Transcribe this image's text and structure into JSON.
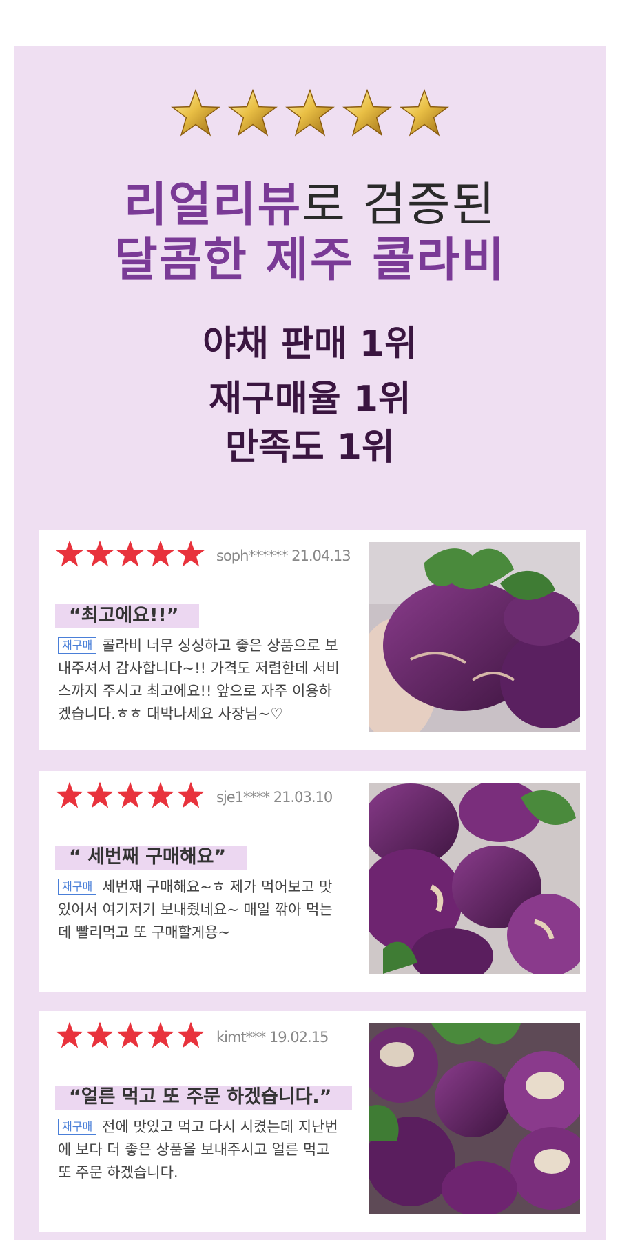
{
  "headline": {
    "line1_bold": "리얼리뷰",
    "line1_rest": "로 검증된",
    "line2": "달콤한 제주 콜라비"
  },
  "rankings": [
    "야채 판매 1위",
    "재구매율 1위",
    "만족도 1위"
  ],
  "star_rating": 5,
  "reviews": [
    {
      "rating": 5,
      "user_date": "soph****** 21.04.13",
      "title": "“최고에요!!”",
      "badge": "재구매",
      "text": "콜라비 너무 싱싱하고 좋은 상품으로 보내주셔서 감사합니다~!! 가격도 저렴한데 서비스까지 주시고 최고에요!! 앞으로 자주 이용하겠습니다.ㅎㅎ 대박나세요 사장님~♡"
    },
    {
      "rating": 5,
      "user_date": "sje1**** 21.03.10",
      "title": "“ 세번째 구매해요”",
      "badge": "재구매",
      "text": "세번재 구매해요~ㅎ 제가 먹어보고 맛있어서 여기저기 보내줬네요~ 매일 깎아 먹는데 빨리먹고 또 구매할게용~"
    },
    {
      "rating": 5,
      "user_date": "kimt*** 19.02.15",
      "title": "“얼른 먹고 또 주문 하겠습니다.”",
      "badge": "재구매",
      "text": "전에 맛있고 먹고 다시 시켰는데 지난번에 보다 더 좋은 상품을 보내주시고 얼른 먹고 또 주문 하겠습니다."
    }
  ],
  "colors": {
    "panel_bg": "#efdff2",
    "accent_purple": "#7a3a96",
    "rank_bar": "#8b4a9f",
    "star_red": "#e8323c",
    "star_gold": "#d9a830",
    "badge_blue": "#4a7fd8"
  },
  "icons": [
    "gold-star-icon",
    "red-star-icon"
  ]
}
